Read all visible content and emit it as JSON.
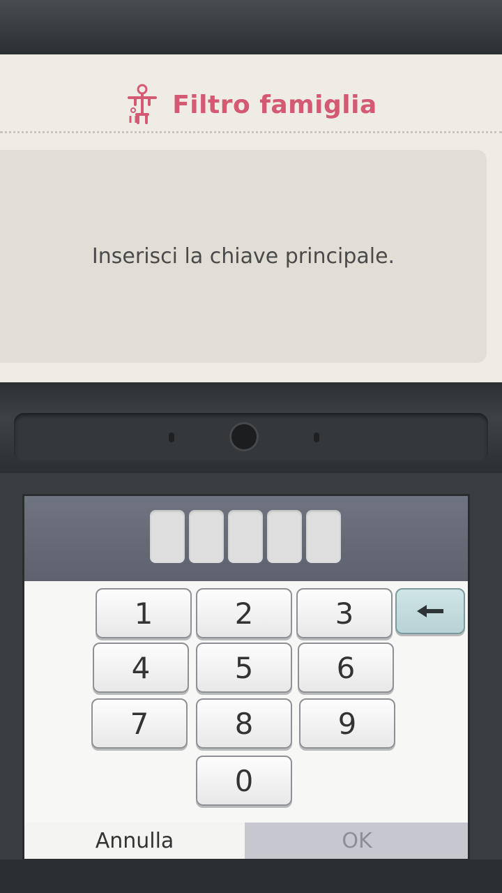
{
  "top_screen": {
    "title": "Filtro famiglia",
    "title_icon": "family-icon",
    "message": "Inserisci la chiave principale.",
    "accent_color": "#d35a72"
  },
  "pin": {
    "length": 5,
    "entered": ""
  },
  "keypad": {
    "keys": [
      "1",
      "2",
      "3",
      "4",
      "5",
      "6",
      "7",
      "8",
      "9",
      "0"
    ],
    "backspace_icon": "arrow-left-icon"
  },
  "bottom_bar": {
    "cancel_label": "Annulla",
    "ok_label": "OK"
  }
}
